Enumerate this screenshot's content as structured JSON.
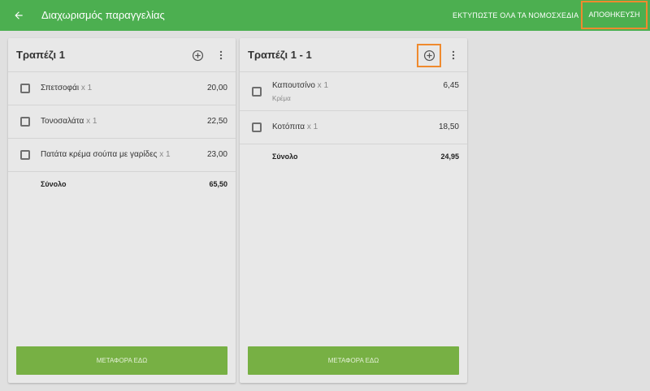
{
  "appbar": {
    "title": "Διαχωρισμός παραγγελίας",
    "print_label": "ΕΚΤΥΠΩΣΤΕ ΟΛΑ ΤΑ ΝΟΜΟΣΧΕΔΙΑ",
    "save_label": "ΑΠΟΘΗΚΕΥΣΗ",
    "back_icon": "arrow-left-icon",
    "color": "#4caf50"
  },
  "cards": [
    {
      "title": "Τραπέζι 1",
      "items": [
        {
          "name": "Σπετσοφάι",
          "qty": "x 1",
          "price": "20,00",
          "note": ""
        },
        {
          "name": "Τονοσαλάτα",
          "qty": "x 1",
          "price": "22,50",
          "note": ""
        },
        {
          "name": "Πατάτα κρέμα σούπα με γαρίδες",
          "qty": "x 1",
          "price": "23,00",
          "note": ""
        }
      ],
      "total_label": "Σύνολο",
      "total": "65,50",
      "move_label": "ΜΕΤΑΦΟΡΑ ΕΔΩ"
    },
    {
      "title": "Τραπέζι 1 - 1",
      "items": [
        {
          "name": "Καπουτσίνο",
          "qty": "x 1",
          "price": "6,45",
          "note": "Κρέμα"
        },
        {
          "name": "Κοτόπιτα",
          "qty": "x 1",
          "price": "18,50",
          "note": ""
        }
      ],
      "total_label": "Σύνολο",
      "total": "24,95",
      "move_label": "ΜΕΤΑΦΟΡΑ ΕΔΩ"
    }
  ],
  "colors": {
    "primary": "#4caf50",
    "button": "#77b044",
    "highlight": "#ef8a2e"
  }
}
